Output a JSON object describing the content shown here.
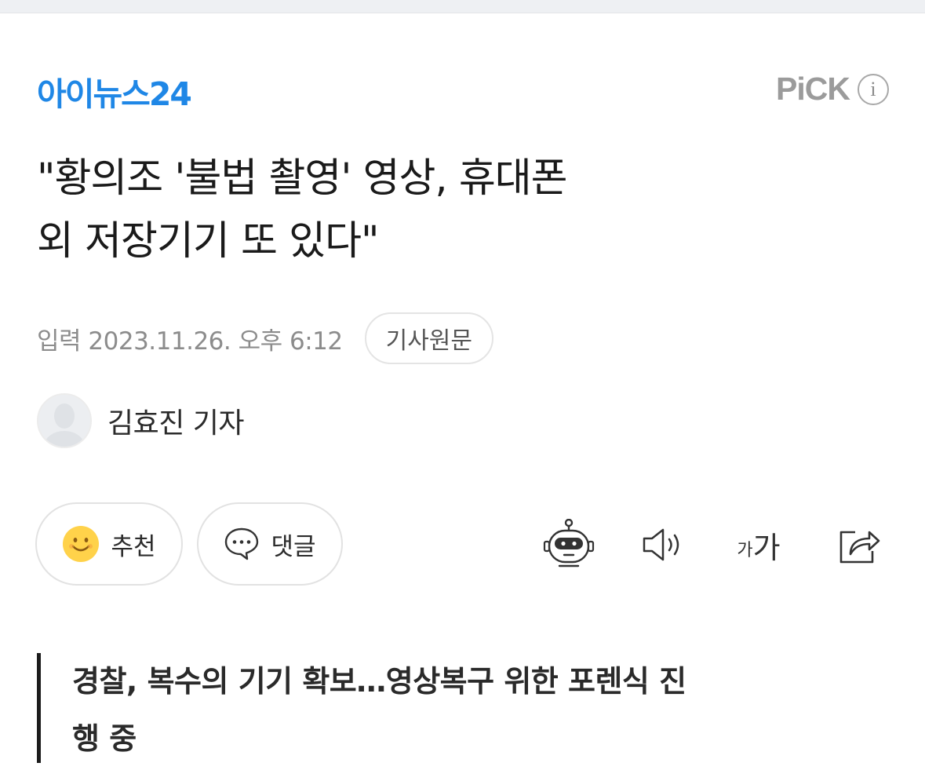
{
  "brand": {
    "logo_text": "아이뉴스24",
    "accent_color": "#1f87e6"
  },
  "pick": {
    "label": "PiCK",
    "info_icon_text": "i"
  },
  "article": {
    "title_line1": "\"황의조 '불법 촬영' 영상, 휴대폰",
    "title_line2": "외 저장기기 또 있다\"",
    "date_text": "입력 2023.11.26. 오후 6:12",
    "original_button": "기사원문",
    "reporter_name": "김효진 기자",
    "subtitle_line1": "경찰, 복수의 기기 확보…영상복구 위한 포렌식 진",
    "subtitle_line2": "행 중"
  },
  "actions": {
    "like_label": "추천",
    "comment_label": "댓글",
    "font_small": "가",
    "font_big": "가",
    "icons": [
      "smile-icon",
      "comment-bubble-icon",
      "robot-summary-icon",
      "speaker-icon",
      "font-size-icon",
      "share-icon"
    ]
  }
}
